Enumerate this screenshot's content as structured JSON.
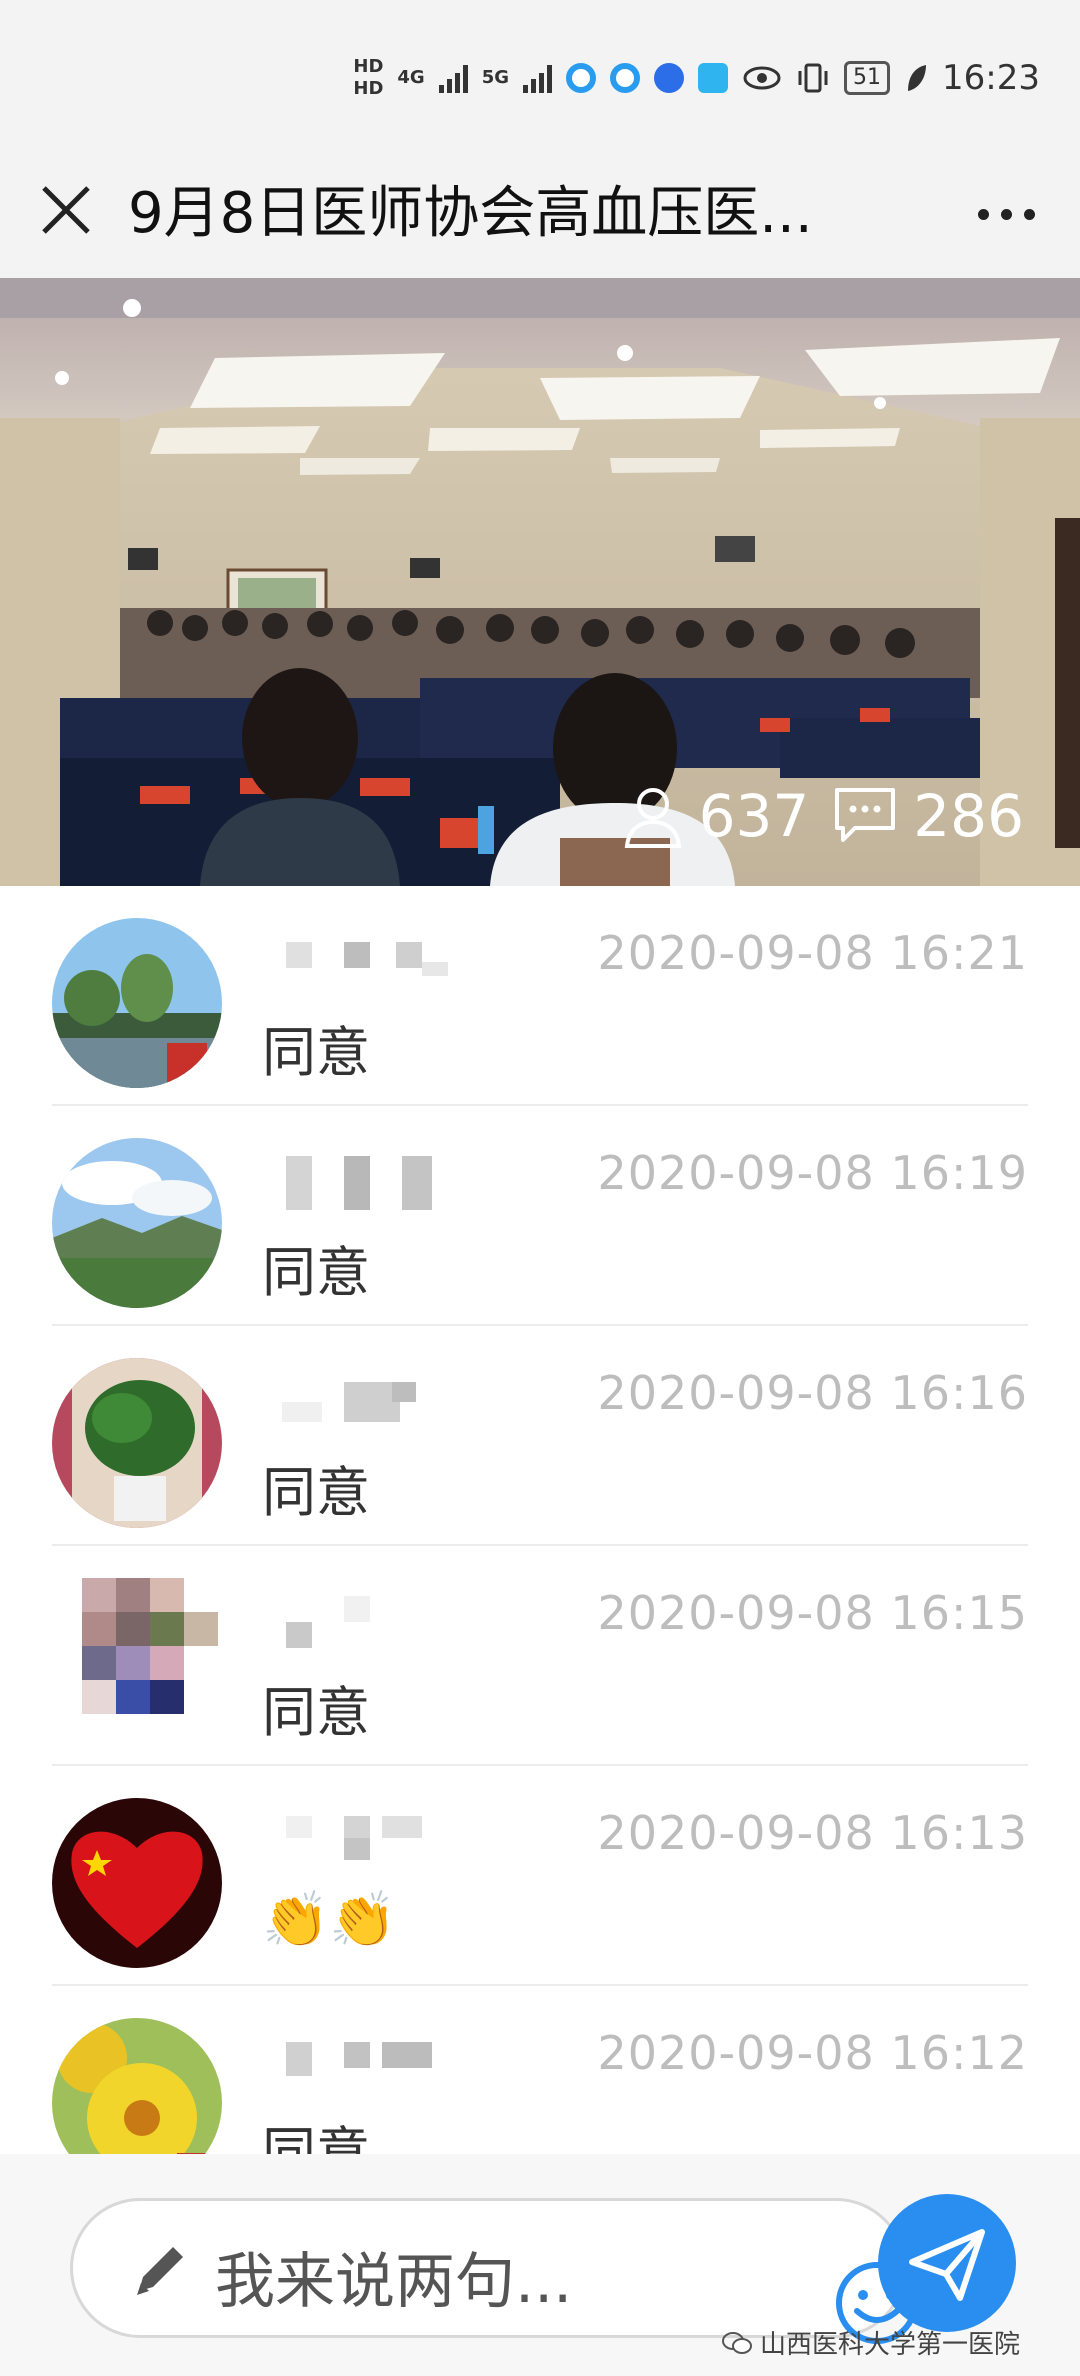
{
  "status_bar": {
    "hd1": "HD",
    "hd2": "HD",
    "net1": "4G",
    "net2": "5G",
    "battery": "51",
    "time": "16:23"
  },
  "header": {
    "title": "9月8日医师协会高血压医...",
    "close_icon": "close-icon",
    "more_icon": "more-icon"
  },
  "live": {
    "viewers": "637",
    "comments": "286"
  },
  "comments": [
    {
      "time": "2020-09-08 16:21",
      "text": "同意",
      "avatar": "landscape-trees"
    },
    {
      "time": "2020-09-08 16:19",
      "text": "同意",
      "avatar": "mountain-sky"
    },
    {
      "time": "2020-09-08 16:16",
      "text": "同意",
      "avatar": "potted-plant"
    },
    {
      "time": "2020-09-08 16:15",
      "text": "同意",
      "avatar": "pixelated"
    },
    {
      "time": "2020-09-08 16:13",
      "text": "👏👏",
      "avatar": "red-heart-flag"
    },
    {
      "time": "2020-09-08 16:12",
      "text": "同意",
      "avatar": "yellow-flowers"
    }
  ],
  "input": {
    "placeholder": "我来说两句..."
  },
  "watermark": "山西医科大学第一医院",
  "colors": {
    "accent": "#2a8ef0",
    "timestamp": "#bdbdbd",
    "bar_bg": "#f3f3f3"
  }
}
